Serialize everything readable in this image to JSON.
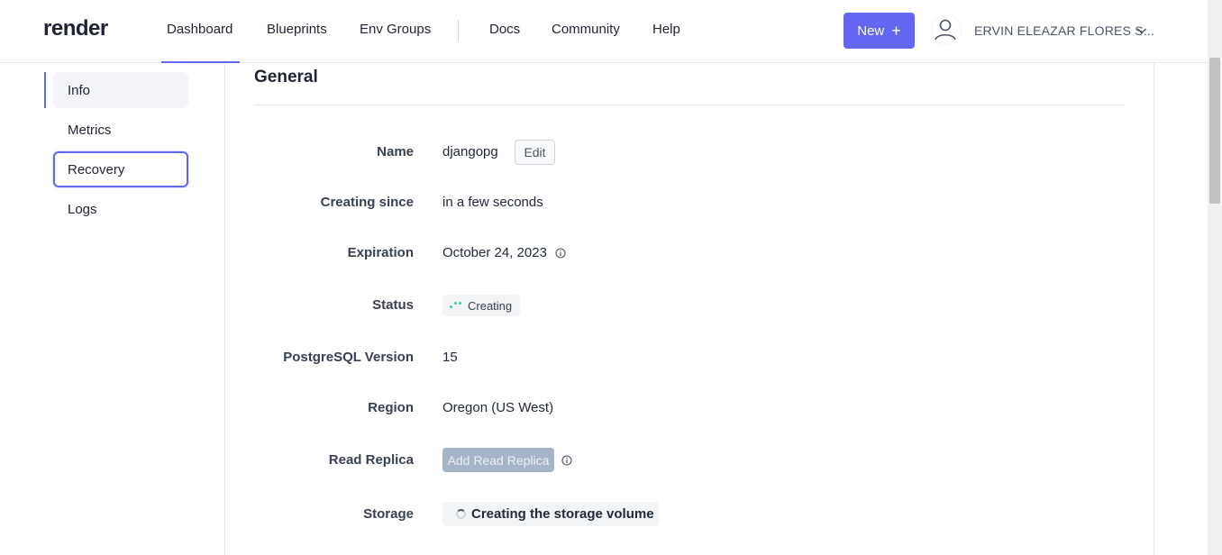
{
  "header": {
    "logo": "render",
    "nav": {
      "dashboard": "Dashboard",
      "blueprints": "Blueprints",
      "env_groups": "Env Groups",
      "docs": "Docs",
      "community": "Community",
      "help": "Help"
    },
    "new_button": "New",
    "new_icon": "plus-icon",
    "user_name": "ERVIN ELEAZAR FLORES S...",
    "accent": "#6366f1"
  },
  "sidebar": {
    "items": [
      {
        "label": "Info",
        "state": "active"
      },
      {
        "label": "Metrics",
        "state": "normal"
      },
      {
        "label": "Recovery",
        "state": "focused"
      },
      {
        "label": "Logs",
        "state": "normal"
      }
    ]
  },
  "general": {
    "title": "General",
    "rows": {
      "name": {
        "label": "Name",
        "value": "djangopg",
        "edit_label": "Edit"
      },
      "creating_since": {
        "label": "Creating since",
        "value": "in a few seconds"
      },
      "expiration": {
        "label": "Expiration",
        "value": "October 24, 2023",
        "icon": "info-icon"
      },
      "status": {
        "label": "Status",
        "value": "Creating",
        "color": "#34d399"
      },
      "postgres_version": {
        "label": "PostgreSQL Version",
        "value": "15"
      },
      "region": {
        "label": "Region",
        "value": "Oregon (US West)"
      },
      "read_replica": {
        "label": "Read Replica",
        "button": "Add Read Replica",
        "icon": "info-icon"
      },
      "storage": {
        "label": "Storage",
        "value": "Creating the storage volume",
        "icon": "spinner-icon"
      }
    }
  }
}
